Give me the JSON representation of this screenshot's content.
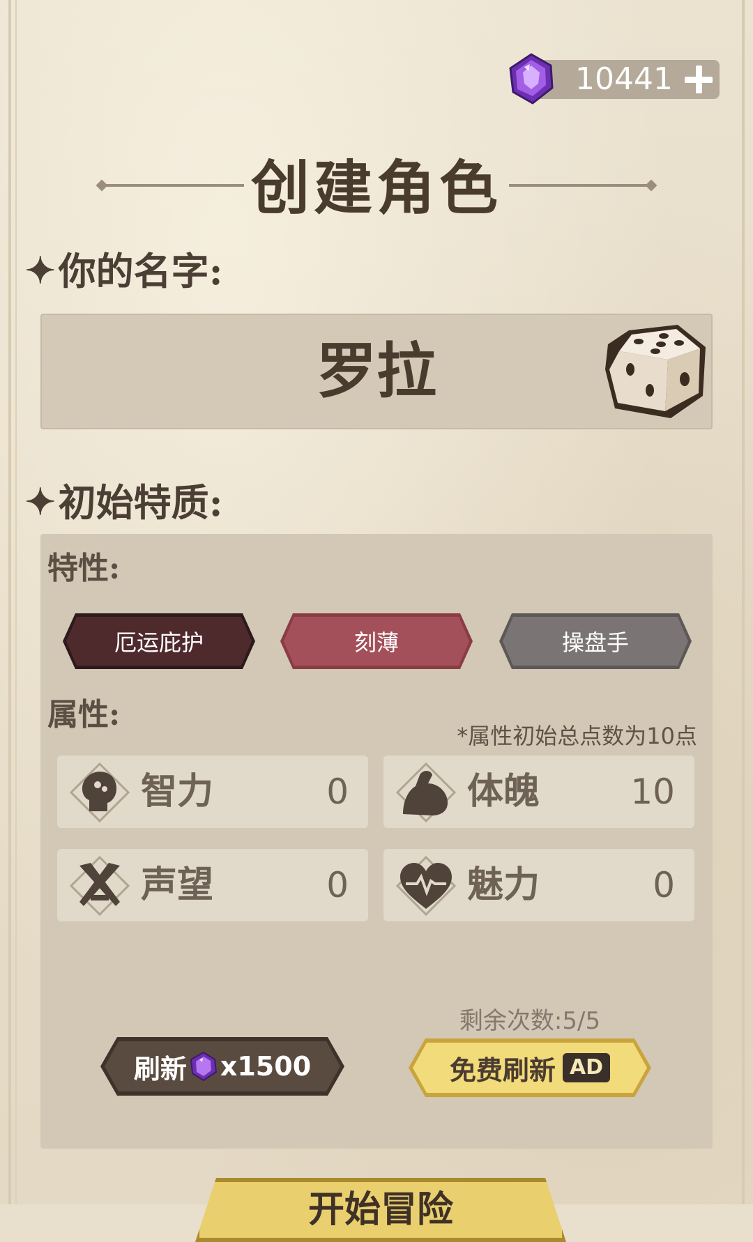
{
  "currency": {
    "value": "10441",
    "icon": "purple-gem-icon"
  },
  "title": "创建角色",
  "name_section": {
    "label": "你的名字:",
    "name_value": "罗拉"
  },
  "traits_section": {
    "label": "初始特质:",
    "traits_label": "特性:",
    "traits": [
      {
        "label": "厄运庇护",
        "color": "#4f2a2d"
      },
      {
        "label": "刻薄",
        "color": "#a4505a"
      },
      {
        "label": "操盘手",
        "color": "#7a7474"
      }
    ],
    "attributes_label": "属性:",
    "attributes_note": "*属性初始总点数为10点",
    "attributes": [
      {
        "name": "智力",
        "value": "0",
        "icon": "brain-head-icon"
      },
      {
        "name": "体魄",
        "value": "10",
        "icon": "muscle-arm-icon"
      },
      {
        "name": "声望",
        "value": "0",
        "icon": "crossed-swords-icon"
      },
      {
        "name": "魅力",
        "value": "0",
        "icon": "heartbeat-icon"
      }
    ]
  },
  "refresh": {
    "label": "刷新",
    "cost": "x1500"
  },
  "free_refresh": {
    "remaining": "剩余次数:5/5",
    "label": "免费刷新",
    "ad": "AD"
  },
  "start_button": {
    "label": "开始冒险"
  },
  "colors": {
    "accent_gold": "#f2db7a",
    "dark_brown": "#5a4b40",
    "gem_purple": "#8a3fd1"
  }
}
